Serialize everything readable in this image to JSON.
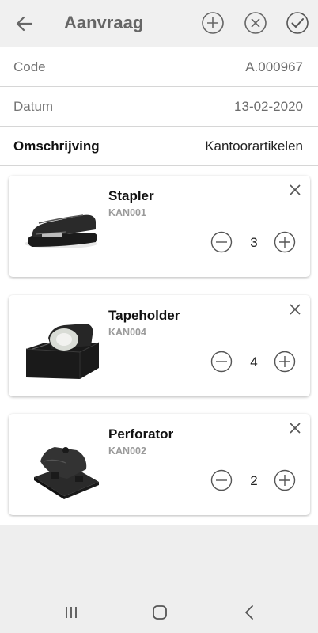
{
  "header": {
    "title": "Aanvraag",
    "icons": {
      "back": "arrow-left-icon",
      "add": "plus-circle-icon",
      "cancel": "x-circle-icon",
      "confirm": "check-circle-icon"
    }
  },
  "fields": {
    "code": {
      "label": "Code",
      "value": "A.000967"
    },
    "datum": {
      "label": "Datum",
      "value": "13-02-2020"
    },
    "omschrijving": {
      "label": "Omschrijving",
      "value": "Kantoorartikelen"
    }
  },
  "items": [
    {
      "name": "Stapler",
      "code": "KAN001",
      "quantity": "3",
      "image": "stapler-image"
    },
    {
      "name": "Tapeholder",
      "code": "KAN004",
      "quantity": "4",
      "image": "tape-dispenser-image"
    },
    {
      "name": "Perforator",
      "code": "KAN002",
      "quantity": "2",
      "image": "hole-punch-image"
    }
  ],
  "navbar": {
    "icons": [
      "recent-apps-icon",
      "home-icon",
      "nav-back-icon"
    ]
  },
  "colors": {
    "appbar": "#f0f0f0",
    "text_muted": "#757575",
    "divider": "#d6d6d6",
    "background_empty": "#eeeeee"
  }
}
